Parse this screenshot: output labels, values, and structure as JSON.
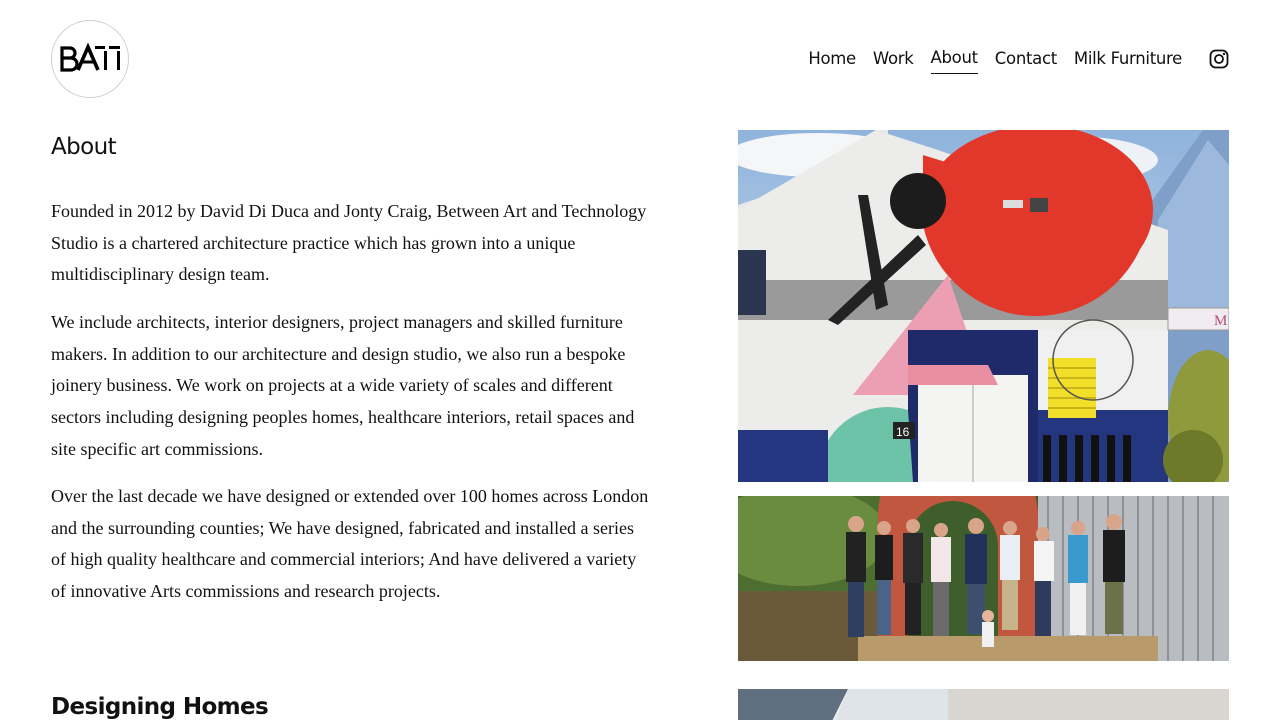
{
  "logo": {
    "text": "BA––",
    "icon": "bat-logo"
  },
  "nav": {
    "items": [
      {
        "label": "Home",
        "active": false
      },
      {
        "label": "Work",
        "active": false
      },
      {
        "label": "About",
        "active": true
      },
      {
        "label": "Contact",
        "active": false
      },
      {
        "label": "Milk Furniture",
        "active": false
      }
    ],
    "social_icon": "instagram-icon"
  },
  "main": {
    "title": "About",
    "paragraphs": [
      "Founded in 2012 by David Di Duca and Jonty Craig, Between Art and Technology Studio is a chartered architecture practice which has grown into a unique multidisciplinary design team.",
      "We include architects, interior designers, project managers and skilled furniture makers. In addition to our architecture and design studio, we also run a bespoke joinery business. We work on projects at a wide variety of scales and different sectors including designing peoples homes, healthcare interiors, retail spaces and site specific art commissions.",
      "Over the last decade we have designed or extended over 100 homes across London and the surrounding counties; We have designed, fabricated and installed a series of high quality healthcare and commercial interiors; And have delivered a variety of innovative Arts commissions and research projects."
    ],
    "next_section_title": "Designing Homes"
  },
  "images": {
    "mural": {
      "sign_text": "M",
      "door_number": "16"
    },
    "team": {},
    "interior": {}
  }
}
